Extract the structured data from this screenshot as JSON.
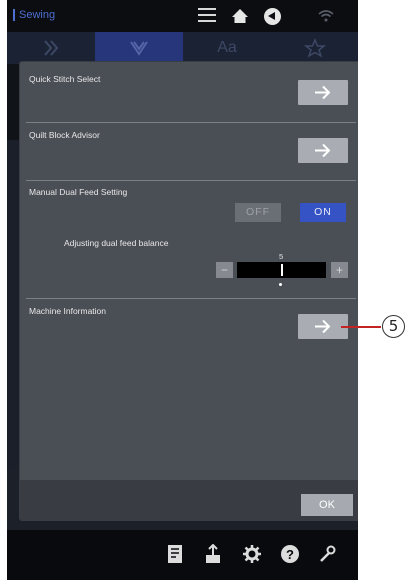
{
  "status_bar": {
    "mode": "Sewing",
    "icons": [
      "menu-icon",
      "home-icon",
      "back-icon",
      "wifi-icon"
    ]
  },
  "background_tabs": {
    "tab_text": "Aa"
  },
  "dialog": {
    "rows": [
      {
        "label": "Quick Stitch Select",
        "action_icon": "arrow-right-icon"
      },
      {
        "label": "Quilt Block Advisor",
        "action_icon": "arrow-right-icon"
      },
      {
        "label": "Manual Dual Feed Setting",
        "options": [
          "OFF",
          "ON"
        ],
        "selected": "ON"
      },
      {
        "label": "Machine Information",
        "action_icon": "arrow-right-icon"
      }
    ],
    "dual_feed_balance": {
      "label": "Adjusting dual feed balance",
      "value": "5",
      "minus_label": "−",
      "plus_label": "+"
    },
    "ok_label": "OK"
  },
  "toolbar": {
    "icons": [
      "stitch-chart-icon",
      "export-icon",
      "settings-icon",
      "help-icon",
      "tools-icon"
    ]
  },
  "callout": {
    "number": "5",
    "line_color": "#c42323"
  },
  "colors": {
    "accent": "#3553c4",
    "dialog_bg": "#4a4e55",
    "screen_bg": "#101318"
  }
}
